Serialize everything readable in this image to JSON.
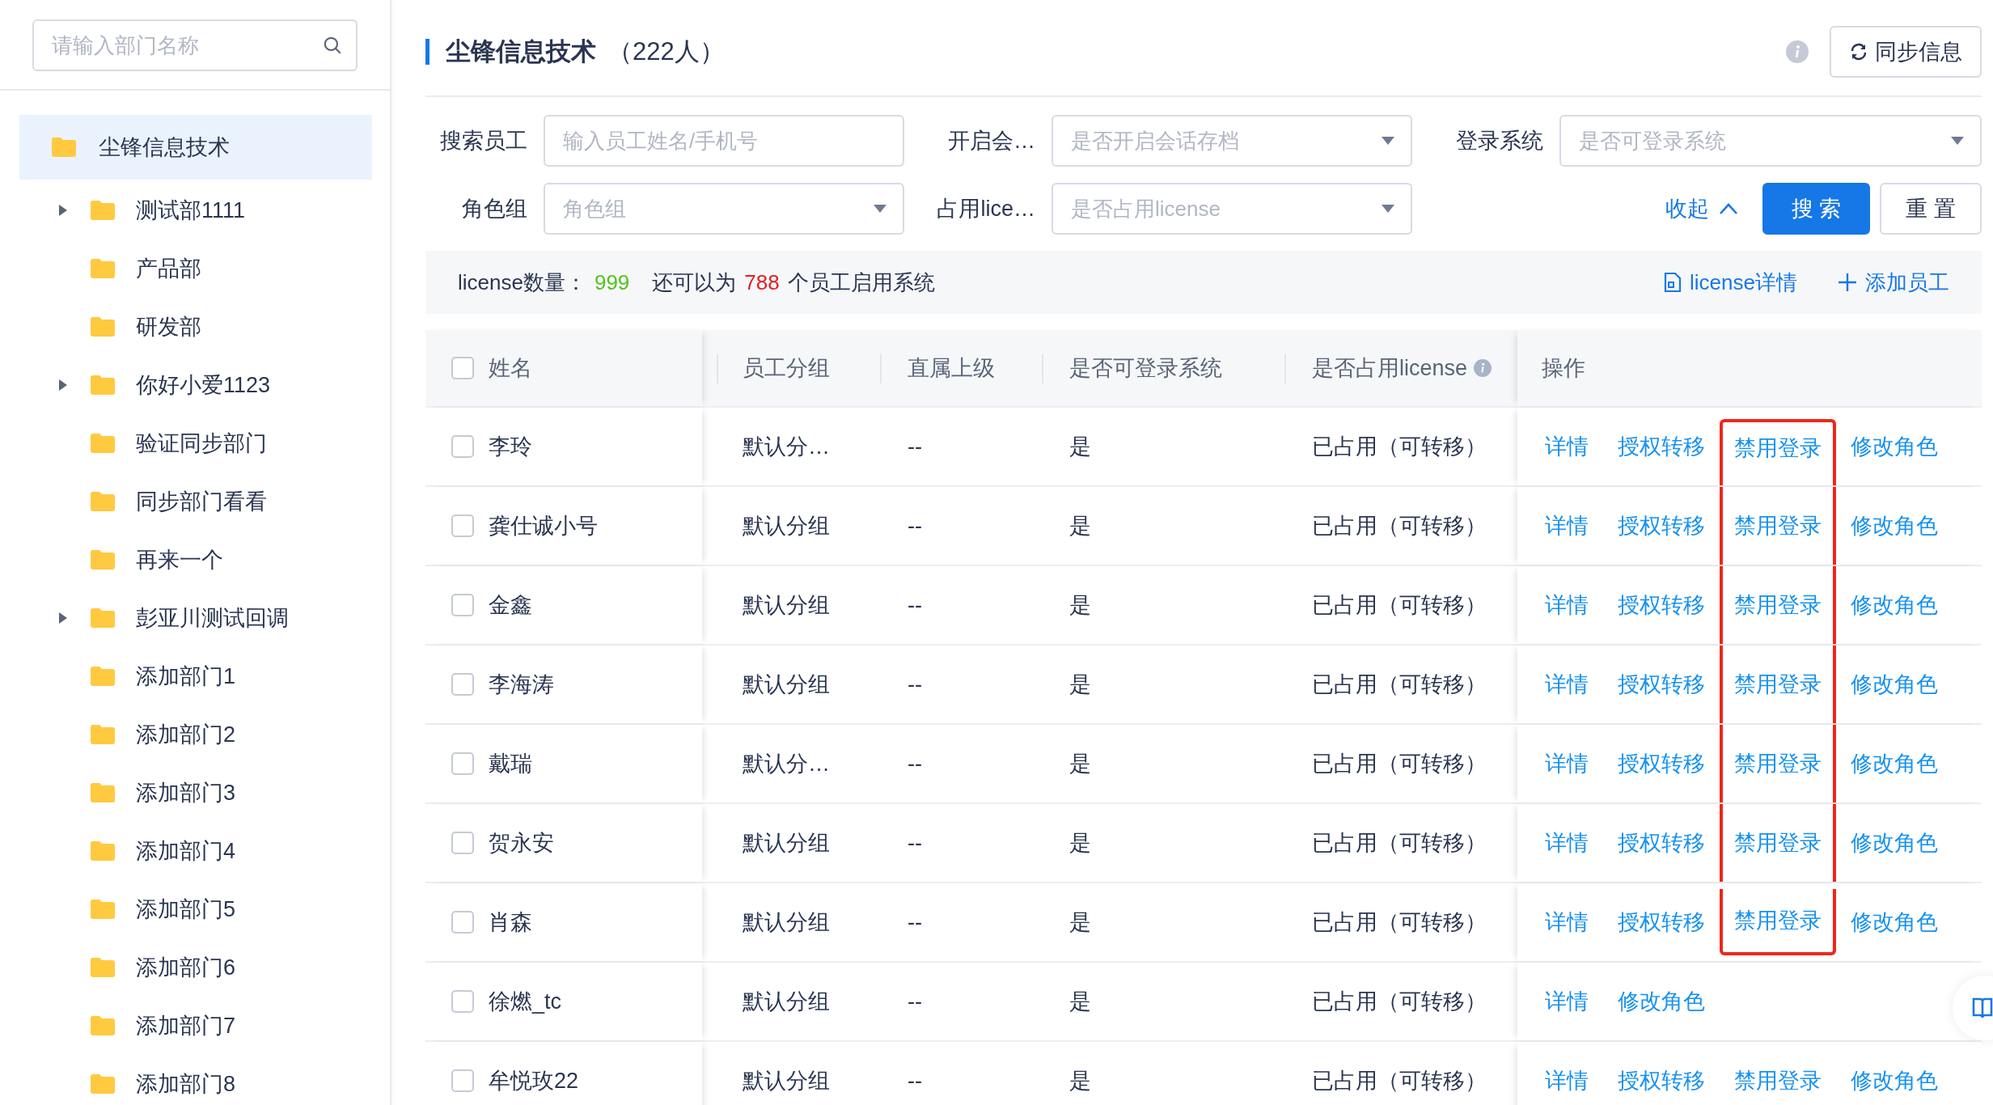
{
  "sidebar": {
    "search": {
      "placeholder": "请输入部门名称"
    },
    "tree": {
      "label": "尘锋信息技术",
      "selected": true,
      "children": [
        {
          "label": "测试部1111",
          "expandable": true,
          "selected": false
        },
        {
          "label": "产品部",
          "expandable": false,
          "selected": false
        },
        {
          "label": "研发部",
          "expandable": false,
          "selected": false
        },
        {
          "label": "你好小爱1123",
          "expandable": true,
          "selected": false
        },
        {
          "label": "验证同步部门",
          "expandable": false,
          "selected": false
        },
        {
          "label": "同步部门看看",
          "expandable": false,
          "selected": false
        },
        {
          "label": "再来一个",
          "expandable": false,
          "selected": false
        },
        {
          "label": "彭亚川测试回调",
          "expandable": true,
          "selected": false
        },
        {
          "label": "添加部门1",
          "expandable": false,
          "selected": false
        },
        {
          "label": "添加部门2",
          "expandable": false,
          "selected": false
        },
        {
          "label": "添加部门3",
          "expandable": false,
          "selected": false
        },
        {
          "label": "添加部门4",
          "expandable": false,
          "selected": false
        },
        {
          "label": "添加部门5",
          "expandable": false,
          "selected": false
        },
        {
          "label": "添加部门6",
          "expandable": false,
          "selected": false
        },
        {
          "label": "添加部门7",
          "expandable": false,
          "selected": false
        },
        {
          "label": "添加部门8",
          "expandable": false,
          "selected": false
        }
      ]
    }
  },
  "header": {
    "title": "尘锋信息技术",
    "count": "（222人）",
    "sync_button": "同步信息"
  },
  "filters": {
    "row_1": [
      {
        "label": "搜索员工",
        "kind": "input",
        "placeholder": "输入员工姓名/手机号"
      },
      {
        "label": "开启会…",
        "kind": "select",
        "placeholder": "是否开启会话存档"
      },
      {
        "label": "登录系统",
        "kind": "select",
        "placeholder": "是否可登录系统"
      }
    ],
    "row_2": [
      {
        "label": "角色组",
        "kind": "select",
        "placeholder": "角色组"
      },
      {
        "label": "占用lice…",
        "kind": "select",
        "placeholder": "是否占用license"
      }
    ],
    "collapse": "收起",
    "search_button": "搜 索",
    "reset_button": "重 置"
  },
  "license_bar": {
    "label": "license数量：",
    "total": "999",
    "middle": "还可以为",
    "remaining": "788",
    "suffix": "个员工启用系统",
    "details_link": "license详情",
    "add_link": "添加员工"
  },
  "table": {
    "select_all_checked": false,
    "columns": [
      "姓名",
      "员工分组",
      "直属上级",
      "是否可登录系统",
      "是否占用license",
      "操作"
    ],
    "rows": [
      {
        "checked": false,
        "name": "李玲",
        "group": "默认分…",
        "manager": "--",
        "can_login": "是",
        "license": "已占用（可转移）",
        "actions": [
          {
            "label": "详情",
            "highlighted": false
          },
          {
            "label": "授权转移",
            "highlighted": false
          },
          {
            "label": "禁用登录",
            "highlighted": true
          },
          {
            "label": "修改角色",
            "highlighted": false
          }
        ]
      },
      {
        "checked": false,
        "name": "龚仕诚小号",
        "group": "默认分组",
        "manager": "--",
        "can_login": "是",
        "license": "已占用（可转移）",
        "actions": [
          {
            "label": "详情",
            "highlighted": false
          },
          {
            "label": "授权转移",
            "highlighted": false
          },
          {
            "label": "禁用登录",
            "highlighted": true
          },
          {
            "label": "修改角色",
            "highlighted": false
          }
        ]
      },
      {
        "checked": false,
        "name": "金鑫",
        "group": "默认分组",
        "manager": "--",
        "can_login": "是",
        "license": "已占用（可转移）",
        "actions": [
          {
            "label": "详情",
            "highlighted": false
          },
          {
            "label": "授权转移",
            "highlighted": false
          },
          {
            "label": "禁用登录",
            "highlighted": true
          },
          {
            "label": "修改角色",
            "highlighted": false
          }
        ]
      },
      {
        "checked": false,
        "name": "李海涛",
        "group": "默认分组",
        "manager": "--",
        "can_login": "是",
        "license": "已占用（可转移）",
        "actions": [
          {
            "label": "详情",
            "highlighted": false
          },
          {
            "label": "授权转移",
            "highlighted": false
          },
          {
            "label": "禁用登录",
            "highlighted": true
          },
          {
            "label": "修改角色",
            "highlighted": false
          }
        ]
      },
      {
        "checked": false,
        "name": "戴瑞",
        "group": "默认分…",
        "manager": "--",
        "can_login": "是",
        "license": "已占用（可转移）",
        "actions": [
          {
            "label": "详情",
            "highlighted": false
          },
          {
            "label": "授权转移",
            "highlighted": false
          },
          {
            "label": "禁用登录",
            "highlighted": true
          },
          {
            "label": "修改角色",
            "highlighted": false
          }
        ]
      },
      {
        "checked": false,
        "name": "贺永安",
        "group": "默认分组",
        "manager": "--",
        "can_login": "是",
        "license": "已占用（可转移）",
        "actions": [
          {
            "label": "详情",
            "highlighted": false
          },
          {
            "label": "授权转移",
            "highlighted": false
          },
          {
            "label": "禁用登录",
            "highlighted": true
          },
          {
            "label": "修改角色",
            "highlighted": false
          }
        ]
      },
      {
        "checked": false,
        "name": "肖森",
        "group": "默认分组",
        "manager": "--",
        "can_login": "是",
        "license": "已占用（可转移）",
        "actions": [
          {
            "label": "详情",
            "highlighted": false
          },
          {
            "label": "授权转移",
            "highlighted": false
          },
          {
            "label": "禁用登录",
            "highlighted": true
          },
          {
            "label": "修改角色",
            "highlighted": false
          }
        ]
      },
      {
        "checked": false,
        "name": "徐燃_tc",
        "group": "默认分组",
        "manager": "--",
        "can_login": "是",
        "license": "已占用（可转移）",
        "actions": [
          {
            "label": "详情",
            "highlighted": false
          },
          {
            "label": "修改角色",
            "highlighted": false
          }
        ]
      },
      {
        "checked": false,
        "name": "牟悦玫22",
        "group": "默认分组",
        "manager": "--",
        "can_login": "是",
        "license": "已占用（可转移）",
        "actions": [
          {
            "label": "详情",
            "highlighted": false
          },
          {
            "label": "授权转移",
            "highlighted": false
          },
          {
            "label": "禁用登录",
            "highlighted": false
          },
          {
            "label": "修改角色",
            "highlighted": false
          }
        ]
      }
    ]
  }
}
